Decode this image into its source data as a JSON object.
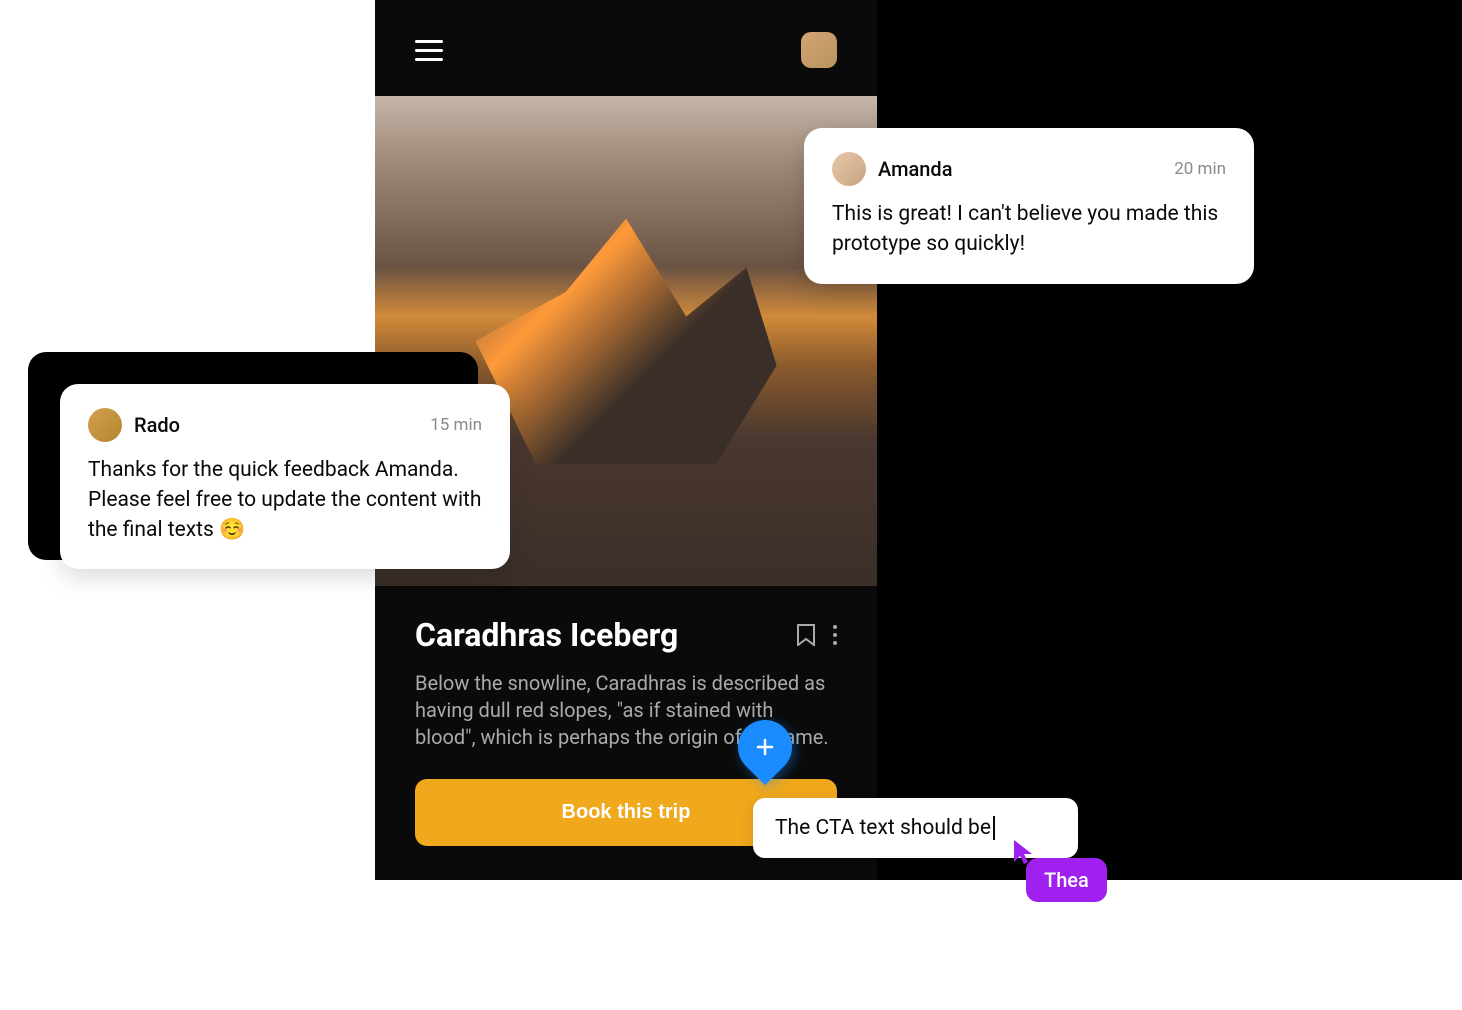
{
  "phone": {
    "title": "Caradhras Iceberg",
    "description": "Below the snowline, Caradhras is described as having dull red slopes, \"as if stained with blood\", which is perhaps the origin of its name.",
    "cta_label": "Book this trip"
  },
  "comments": {
    "amanda": {
      "name": "Amanda",
      "time": "20 min",
      "body": "This is great! I can't believe you made this prototype so quickly!"
    },
    "rado": {
      "name": "Rado",
      "time": "15 min",
      "body": "Thanks for the quick feedback Amanda. Please feel free to update the content with the final texts ☺️"
    }
  },
  "inline_comment": {
    "value": "The CTA text should be"
  },
  "cursor": {
    "user": "Thea"
  }
}
